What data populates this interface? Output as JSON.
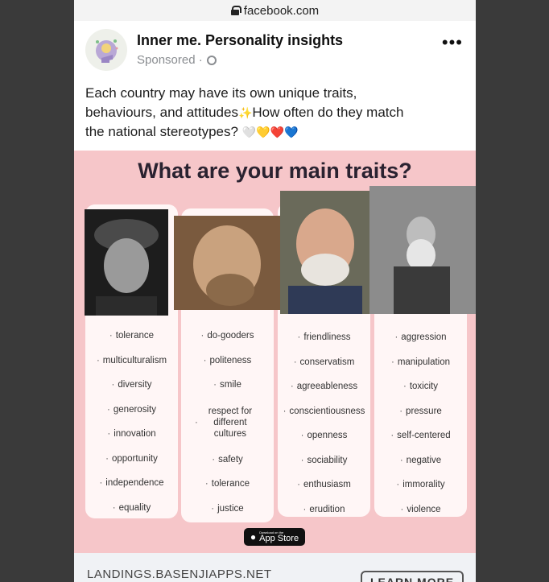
{
  "browser": {
    "url": "facebook.com"
  },
  "post": {
    "page_name": "Inner me. Personality insights",
    "sponsored": "Sponsored ·",
    "caption_line1": "Each country may have its own unique traits,",
    "caption_line2a": "behaviours, and attitudes",
    "caption_line2b": "How often do they match",
    "caption_line3": "the national stereotypes?",
    "emojis": "🤍💛❤️💙",
    "sparkles": "✨"
  },
  "ad": {
    "title": "What are your main traits?",
    "columns": [
      {
        "traits": [
          "tolerance",
          "multiculturalism",
          "diversity",
          "generosity",
          "innovation",
          "opportunity",
          "independence",
          "equality"
        ]
      },
      {
        "traits": [
          "do-gooders",
          "politeness",
          "smile",
          "respect for different cultures",
          "safety",
          "tolerance",
          "justice"
        ]
      },
      {
        "traits": [
          "friendliness",
          "conservatism",
          "agreeableness",
          "conscientiousness",
          "openness",
          "sociability",
          "enthusiasm",
          "erudition"
        ]
      },
      {
        "traits": [
          "aggression",
          "manipulation",
          "toxicity",
          "pressure",
          "self-centered",
          "negative",
          "immorality",
          "violence"
        ]
      }
    ],
    "appstore_small": "Download on the",
    "appstore_big": "App Store"
  },
  "cta": {
    "domain": "LANDINGS.BASENJIAPPS.NET",
    "button": "LEARN MORE"
  },
  "colors": {
    "ad_bg": "#f6c6c9",
    "card_bg": "#fff6f6",
    "title": "#2a2230"
  }
}
